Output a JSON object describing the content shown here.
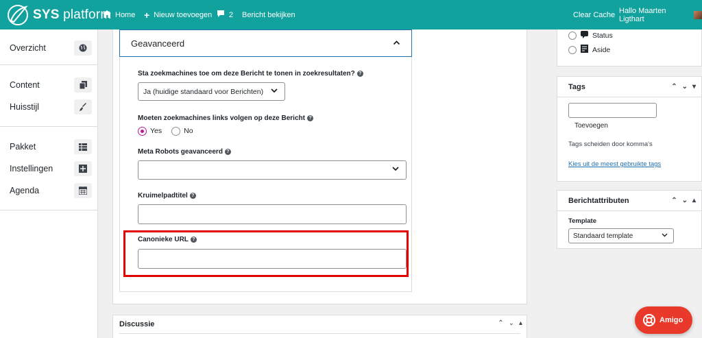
{
  "colors": {
    "topbar": "#12a29d",
    "accent": "#2271b1",
    "radio_selected": "#c0179a",
    "highlight": "#e00000",
    "amigo": "#e8392b"
  },
  "topbar": {
    "brand_strong": "SYS",
    "brand_light": "platform",
    "home": "Home",
    "new": "Nieuw toevoegen",
    "comments_count": "2",
    "view": "Bericht bekijken",
    "cache": "Clear Cache",
    "user": "Hallo Maarten Ligthart"
  },
  "sidebar": {
    "items": [
      {
        "label": "Overzicht",
        "icon": "globe-icon"
      },
      {
        "label": "Content",
        "icon": "copy-icon"
      },
      {
        "label": "Huisstijl",
        "icon": "brush-icon"
      },
      {
        "label": "Pakket",
        "icon": "table-icon"
      },
      {
        "label": "Instellingen",
        "icon": "settings-icon"
      },
      {
        "label": "Agenda",
        "icon": "calendar-icon"
      }
    ]
  },
  "advanced": {
    "title": "Geavanceerd",
    "q_search": "Sta zoekmachines toe om deze Bericht te tonen in zoekresultaten?",
    "q_search_value": "Ja (huidige standaard voor Berichten)",
    "q_follow": "Moeten zoekmachines links volgen op deze Bericht",
    "opt_yes": "Yes",
    "opt_no": "No",
    "meta_robots": "Meta Robots geavanceerd",
    "breadcrumb_title": "Kruimelpadtitel",
    "canonical": "Canonieke URL"
  },
  "discussion": {
    "title": "Discussie"
  },
  "format": {
    "status": "Status",
    "aside": "Aside"
  },
  "tags": {
    "title": "Tags",
    "add": "Toevoegen",
    "hint": "Tags scheiden door komma's",
    "link": "Kies uit de meest gebruikte tags"
  },
  "attributes": {
    "title": "Berichtattributen",
    "template_label": "Template",
    "template_value": "Standaard template"
  },
  "amigo": {
    "label": "Amigo"
  }
}
